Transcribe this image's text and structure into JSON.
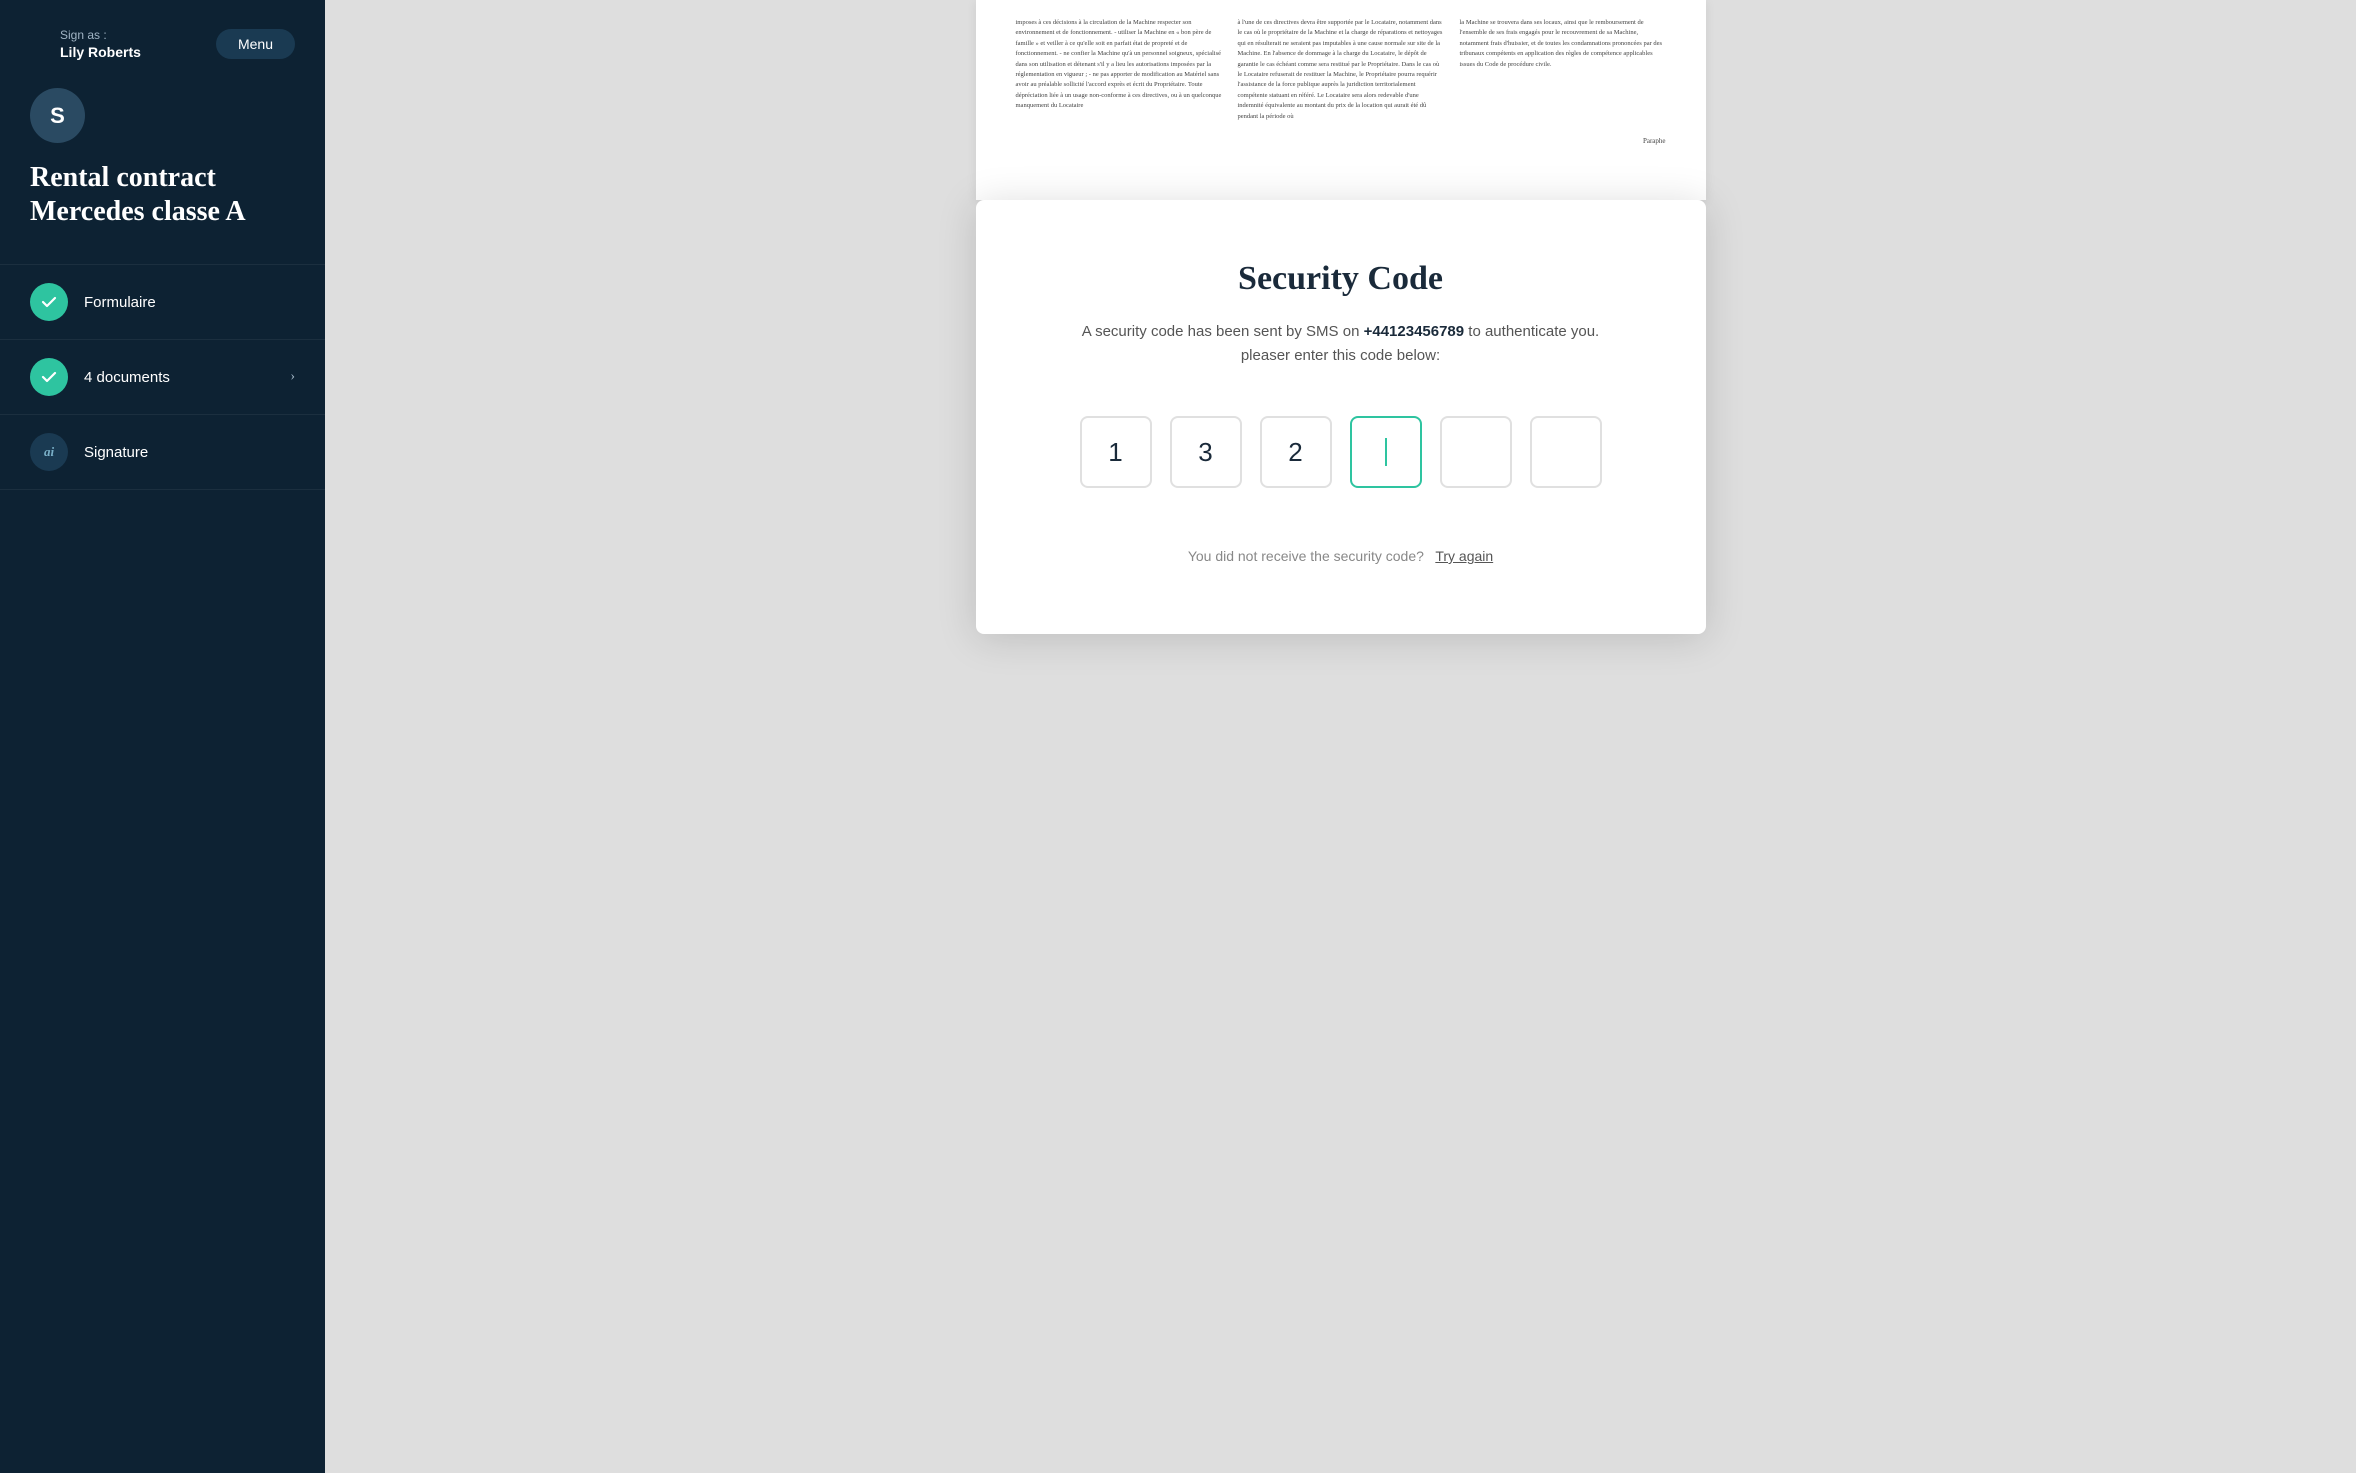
{
  "sidebar": {
    "sign_as_label": "Sign as :",
    "user_name": "Lily Roberts",
    "menu_button": "Menu",
    "avatar_initials": "S",
    "contract_title": "Rental contract Mercedes classe A",
    "nav_items": [
      {
        "id": "formulaire",
        "label": "Formulaire",
        "type": "check",
        "has_arrow": false
      },
      {
        "id": "documents",
        "label": "4 documents",
        "type": "check",
        "has_arrow": true
      },
      {
        "id": "signature",
        "label": "Signature",
        "type": "sig",
        "has_arrow": false
      }
    ]
  },
  "modal": {
    "title": "Security Code",
    "description_prefix": "A security code has been sent by SMS on ",
    "phone": "+44123456789",
    "description_suffix": " to authenticate you. pleaser enter this code below:",
    "code_digits": [
      "1",
      "3",
      "2",
      "",
      "",
      ""
    ],
    "resend_text": "You did not receive the security code?",
    "resend_link": "Try again"
  },
  "document": {
    "col1_text": "imposes à ces décisions à la circulation de la Machine respecter son environnement et de fonctionnement. - utiliser la Machine en « bon père de famille » et veiller à ce qu'elle soit en parfait état de propreté et de fonctionnement. - ne confier la Machine qu'à un personnel soigneux, spécialisé dans son utilisation et détenant s'il y a lieu les autorisations imposées par la réglementation en vigueur ; - ne pas apporter de modification au Matériel sans avoir au préalable sollicité l'accord exprès et écrit du Propriétaire. Toute dépréciation liée à un usage non-conforme à ces directives, ou à un quelconque manquement du Locataire",
    "col2_text": "à l'une de ces directives devra être supportée par le Locataire, notamment dans le cas où le propriétaire de la Machine et la charge de réparations et nettoyages qui en résulterait ne seraient pas imputables à une cause normale sur site de la Machine. En l'absence de dommage à la charge du Locataire, le dépôt de garantie le cas échéant comme sera restitué par le Propriétaire. Dans le cas où le Locataire refuserait de restituer la Machine, le Propriétaire pourra requérir l'assistance de la force publique auprès la juridiction territorialement compétente statuant en référé. Le Locataire sera alors redevable d'une indemnité équivalente au montant du prix de la location qui aurait été dû pendant la période où",
    "col3_text": "la Machine se trouvera dans ses locaux, ainsi que le remboursement de l'ensemble de ses frais engagés pour le recouvrement de sa Machine, notamment frais d'huissier, et de toutes les condamnations prononcées par des tribunaux compétents en application des règles de compétence applicables issues du Code de procédure civile.",
    "paraphe": "Paraphe"
  }
}
